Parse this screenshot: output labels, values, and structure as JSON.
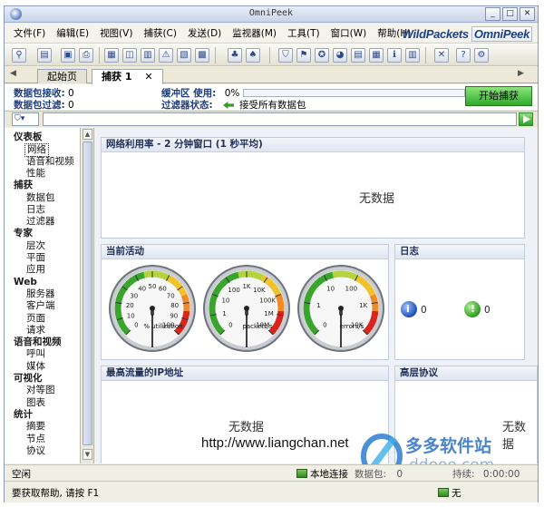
{
  "window": {
    "title": "OmniPeek"
  },
  "menu": {
    "items": [
      "文件(F)",
      "编辑(E)",
      "视图(V)",
      "捕获(C)",
      "发送(D)",
      "监视器(M)",
      "工具(T)",
      "窗口(W)",
      "帮助(H)"
    ],
    "brand_1": "WildPackets",
    "brand_2": "OmniPeek"
  },
  "tabs": [
    {
      "label": "起始页"
    },
    {
      "label": "捕获 1"
    }
  ],
  "status": {
    "packets_received_label": "数据包接收:",
    "packets_received_value": "0",
    "packets_filtered_label": "数据包过滤:",
    "packets_filtered_value": "0",
    "buffer_label": "缓冲区 使用:",
    "buffer_value": "0%",
    "filter_state_label": "过滤器状态:",
    "filter_state_value": "接受所有数据包",
    "start_button": "开始捕获"
  },
  "nav": {
    "groups": [
      {
        "label": "仪表板",
        "items": [
          "网络",
          "语音和视频",
          "性能"
        ]
      },
      {
        "label": "捕获",
        "items": [
          "数据包",
          "日志",
          "过滤器"
        ]
      },
      {
        "label": "专家",
        "items": [
          "层次",
          "平面",
          "应用"
        ]
      },
      {
        "label": "Web",
        "items": [
          "服务器",
          "客户端",
          "页面",
          "请求"
        ]
      },
      {
        "label": "语音和视频",
        "items": [
          "呼叫",
          "媒体"
        ]
      },
      {
        "label": "可视化",
        "items": [
          "对等图",
          "图表"
        ]
      },
      {
        "label": "统计",
        "items": [
          "摘要",
          "节点",
          "协议"
        ]
      }
    ],
    "selected": "网络"
  },
  "panels": {
    "utilization": {
      "title": "网络利用率 - 2 分钟窗口 (1 秒平均)",
      "empty": "无数据"
    },
    "activity": {
      "title": "当前活动"
    },
    "log": {
      "title": "日志",
      "info_count": "0",
      "ok_count": "0"
    },
    "top_ip": {
      "title": "最高流量的IP地址",
      "empty": "无数据"
    },
    "protocols": {
      "title": "高层协议",
      "empty": "无数据"
    }
  },
  "gauges": [
    {
      "unit": "% utilization",
      "ticks": [
        "0",
        "10",
        "20",
        "30",
        "40",
        "50",
        "60",
        "70",
        "80",
        "90",
        "100"
      ],
      "value": "0"
    },
    {
      "unit": "packets/s",
      "ticks": [
        "0",
        "1",
        "10",
        "100",
        "1K",
        "10K",
        "100K",
        "1M",
        "10M"
      ],
      "value": "0"
    },
    {
      "unit": "errors/s",
      "ticks": [
        "0",
        "1",
        "10",
        "100",
        "1K",
        "10K"
      ],
      "value": "0"
    }
  ],
  "watermark": {
    "url": "http://www.liangchan.net",
    "site_cn": "多多软件站",
    "site_en": "ddooo.com"
  },
  "statusbar": {
    "state": "空闲",
    "connection": "本地连接",
    "packets_label": "数据包:",
    "packets_value": "0",
    "duration_label": "持续:",
    "duration_value": "0:00:00",
    "help_text": "要获取帮助, 请按 F1",
    "bottom_right": "无"
  },
  "colors": {
    "start_button": "#2fa92a",
    "accent": "#1d3f86",
    "gauge_red": "#d9261c",
    "gauge_green": "#39a52d"
  }
}
